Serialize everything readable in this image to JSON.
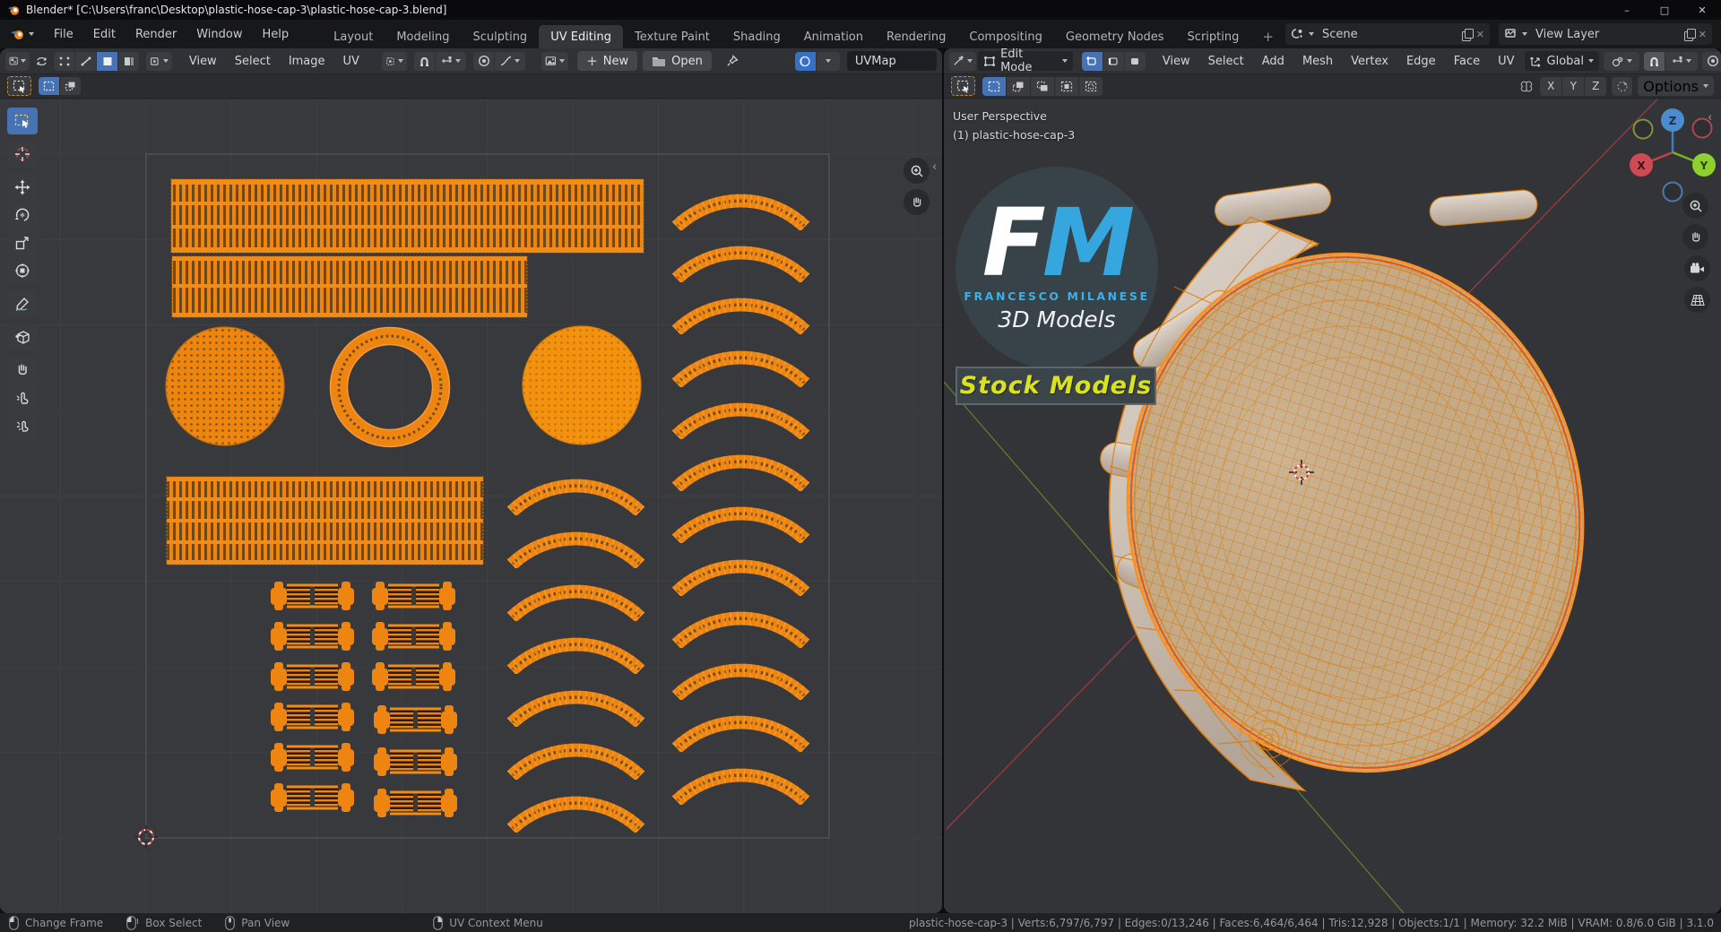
{
  "window": {
    "title": "Blender* [C:\\Users\\franc\\Desktop\\plastic-hose-cap-3\\plastic-hose-cap-3.blend]",
    "minimize": "–",
    "maximize": "□",
    "close": "✕"
  },
  "icons": {
    "chevron": "",
    "close_x": "✕",
    "plus": "+",
    "collapse_left": "‹"
  },
  "topbar": {
    "menus": [
      "File",
      "Edit",
      "Render",
      "Window",
      "Help"
    ],
    "workspaces": [
      "Layout",
      "Modeling",
      "Sculpting",
      "UV Editing",
      "Texture Paint",
      "Shading",
      "Animation",
      "Rendering",
      "Compositing",
      "Geometry Nodes",
      "Scripting"
    ],
    "active_workspace": "UV Editing",
    "add_tab": "+",
    "scene_label": "Scene",
    "view_layer_label": "View Layer"
  },
  "uv_editor": {
    "menus": [
      "View",
      "Select",
      "Image",
      "UV"
    ],
    "new_button": "New",
    "open_button": "Open",
    "uv_map_name": "UVMap",
    "tools": [
      "select-box",
      "cursor",
      "move",
      "rotate",
      "scale",
      "transform",
      "annotate",
      "rip-region",
      "grab",
      "relax",
      "pinch"
    ]
  },
  "viewport3d": {
    "mode": "Edit Mode",
    "menus": [
      "View",
      "Select",
      "Add",
      "Mesh",
      "Vertex",
      "Edge",
      "Face",
      "UV"
    ],
    "orientation": "Global",
    "axis_x": "X",
    "axis_y": "Y",
    "axis_z": "Z",
    "options_label": "Options",
    "overlay_perspective": "User Perspective",
    "overlay_object": "(1) plastic-hose-cap-3",
    "gizmo": {
      "x": "X",
      "y": "Y",
      "z": "Z"
    }
  },
  "watermark": {
    "initial_f": "F",
    "initial_m": "M",
    "name": "FRANCESCO MILANESE",
    "subtitle": "3D Models",
    "banner": "Stock Models"
  },
  "status_bar": {
    "left": [
      {
        "label": "Change Frame"
      },
      {
        "label": "Box Select"
      },
      {
        "label": "Pan View"
      },
      {
        "label": "UV Context Menu"
      }
    ],
    "info": "plastic-hose-cap-3 | Verts:6,797/6,797 | Edges:0/13,246 | Faces:6,464/6,464 | Tris:12,928 | Objects:1/1 | Memory: 32.2 MiB | VRAM: 0.8/6.0 GiB | 3.1.0"
  },
  "colors": {
    "selection_orange": "#ee8511",
    "blender_blue": "#4772b3",
    "fm_blue": "#35a7de",
    "stock_yellow": "#d9e21e",
    "axis_red": "#b23a45",
    "axis_green": "#6a8f2a"
  }
}
